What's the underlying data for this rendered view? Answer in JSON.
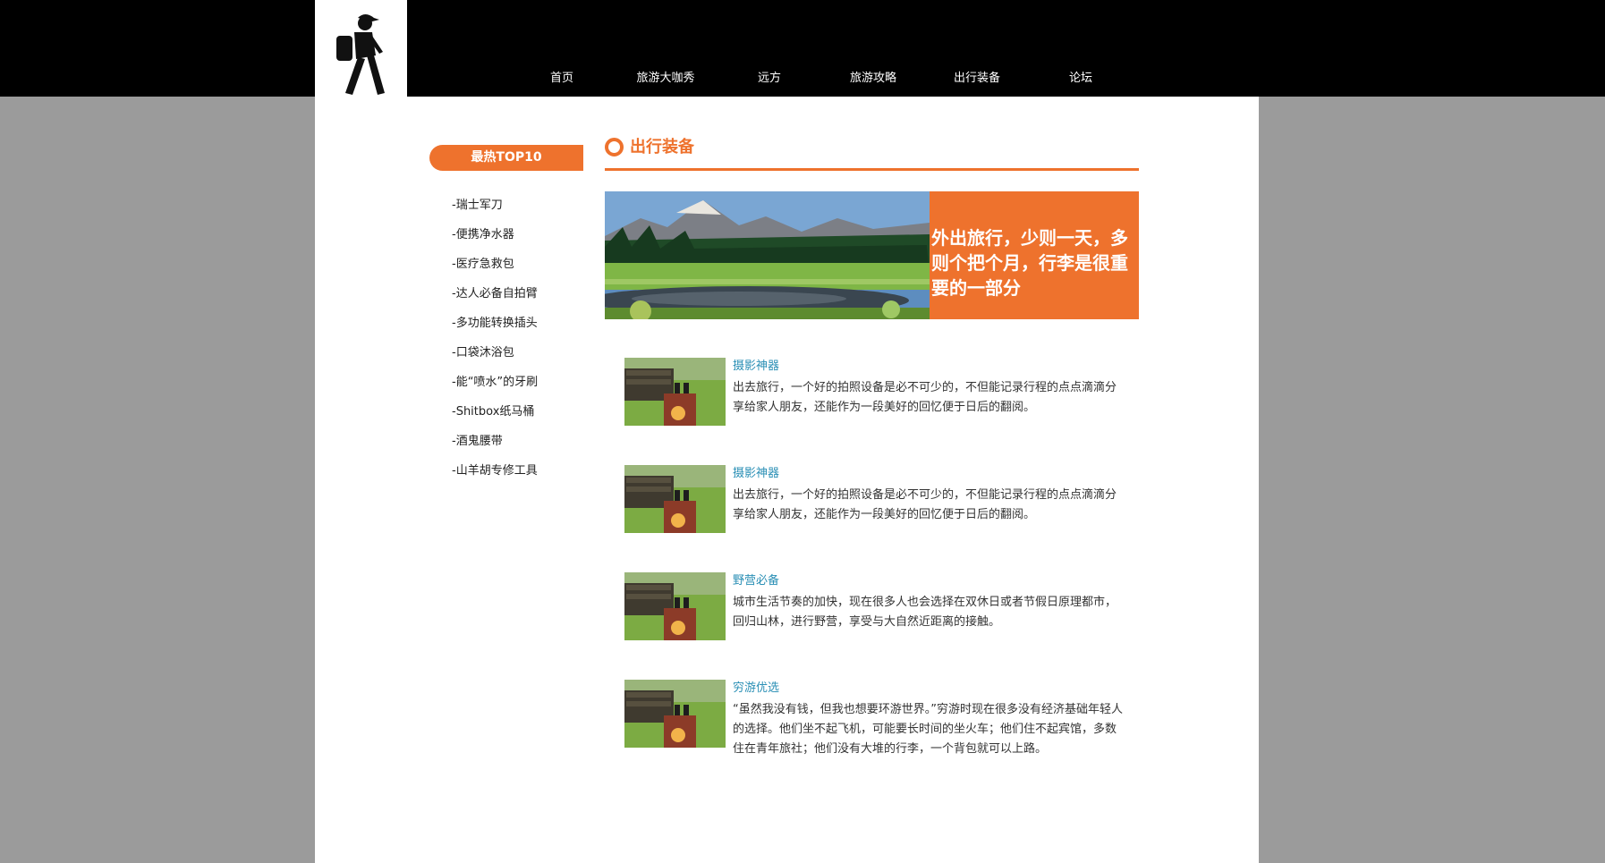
{
  "nav": {
    "items": [
      {
        "label": "首页"
      },
      {
        "label": "旅游大咖秀"
      },
      {
        "label": "远方"
      },
      {
        "label": "旅游攻略"
      },
      {
        "label": "出行装备"
      },
      {
        "label": "论坛"
      }
    ]
  },
  "sidebar": {
    "title": "最热TOP10",
    "items": [
      {
        "label": "-瑞士军刀"
      },
      {
        "label": "-便携净水器"
      },
      {
        "label": "-医疗急救包"
      },
      {
        "label": "-达人必备自拍臂"
      },
      {
        "label": "-多功能转换插头"
      },
      {
        "label": "-口袋沐浴包"
      },
      {
        "label": "-能“喷水”的牙刷"
      },
      {
        "label": "-Shitbox纸马桶"
      },
      {
        "label": "-酒鬼腰带"
      },
      {
        "label": "-山羊胡专修工具"
      }
    ]
  },
  "main": {
    "section_title": "出行装备",
    "banner_text": "外出旅行，少则一天，多则个把个月，行李是很重要的一部分",
    "articles": [
      {
        "title": "摄影神器",
        "body": "出去旅行，一个好的拍照设备是必不可少的，不但能记录行程的点点滴滴分享给家人朋友，还能作为一段美好的回忆便于日后的翻阅。"
      },
      {
        "title": "摄影神器",
        "body": "出去旅行，一个好的拍照设备是必不可少的，不但能记录行程的点点滴滴分享给家人朋友，还能作为一段美好的回忆便于日后的翻阅。"
      },
      {
        "title": "野营必备",
        "body": "城市生活节奏的加快，现在很多人也会选择在双休日或者节假日原理都市，回归山林，进行野营，享受与大自然近距离的接触。"
      },
      {
        "title": "穷游优选",
        "body": "“虽然我没有钱，但我也想要环游世界。”穷游时现在很多没有经济基础年轻人的选择。他们坐不起飞机，可能要长时间的坐火车；他们住不起宾馆，多数住在青年旅社；他们没有大堆的行李，一个背包就可以上路。"
      }
    ]
  },
  "colors": {
    "accent": "#ee722d",
    "link": "#2a8fb5",
    "header": "#000000",
    "background": "#9b9b9b"
  },
  "icons": {
    "logo": "hiker-icon",
    "section": "ring-icon"
  }
}
